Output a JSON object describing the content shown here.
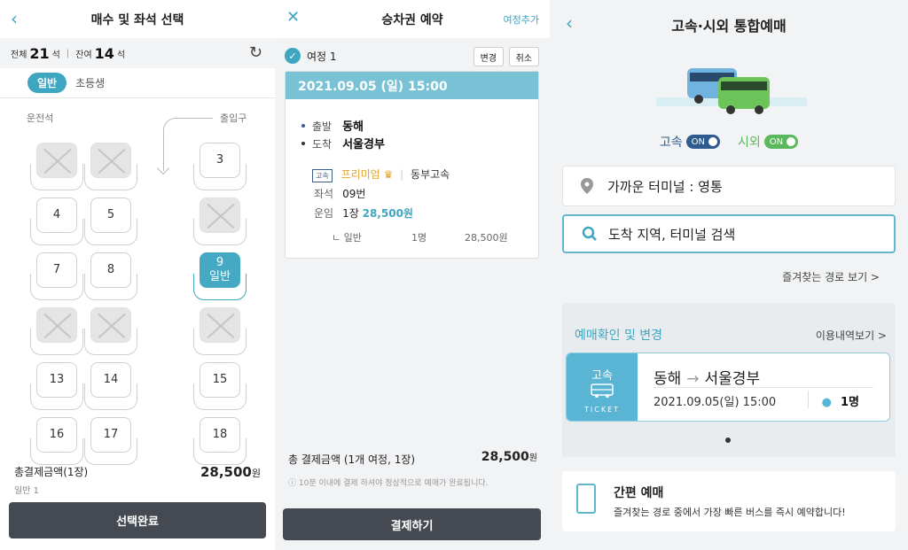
{
  "seat_screen": {
    "title": "매수 및 좌석 선택",
    "total_label": "전체",
    "total_count": "21",
    "remain_label": "잔여",
    "remain_count": "14",
    "unit": "석",
    "tab_general": "일반",
    "tab_child": "초등생",
    "driver_label": "운전석",
    "door_label": "출입구",
    "seats": {
      "s3": "3",
      "s4": "4",
      "s5": "5",
      "s7": "7",
      "s8": "8",
      "s9_num": "9",
      "s9_type": "일반",
      "s13": "13",
      "s14": "14",
      "s15": "15",
      "s16": "16",
      "s17": "17",
      "s18": "18"
    },
    "total_fare_label": "총결제금액(1장)",
    "total_fare": "28,500",
    "won": "원",
    "fare_sub": "일반 1",
    "confirm_button": "선택완료"
  },
  "booking_screen": {
    "title": "승차권 예약",
    "add_trip": "여정추가",
    "trip_label": "여정 1",
    "change_button": "변경",
    "cancel_button": "취소",
    "datetime": "2021.09.05 (일) 15:00",
    "depart_label": "출발",
    "depart": "동해",
    "arrive_label": "도착",
    "arrive": "서울경부",
    "grade_badge": "고속",
    "grade": "프리미엄",
    "company": "동부고속",
    "seat_label": "좌석",
    "seat_value": "09번",
    "fare_label": "운임",
    "fare_count": "1장",
    "fare_value": "28,500원",
    "fare_detail_type": "ㄴ 일반",
    "fare_detail_count": "1명",
    "fare_detail_amount": "28,500원",
    "total_label": "총 결제금액 (1개 여정, 1장)",
    "total_amount": "28,500",
    "won": "원",
    "notice": "ⓘ 10분 이내에 결제 하셔야 정상적으로 예매가 완료됩니다.",
    "pay_button": "결제하기"
  },
  "home_screen": {
    "title": "고속·시외 통합예매",
    "express_label": "고속",
    "express_state": "ON",
    "intercity_label": "시외",
    "intercity_state": "ON",
    "nearest_terminal": "가까운 터미널 : 영통",
    "search_placeholder": "도착 지역, 터미널 검색",
    "favorites_link": "즐겨찾는 경로 보기 >",
    "reservation_header": "예매확인 및 변경",
    "history_link": "이용내역보기 >",
    "ticket_type": "고속",
    "ticket_word": "TICKET",
    "ticket_from": "동해",
    "ticket_to": "서울경부",
    "ticket_date": "2021.09.05(일) 15:00",
    "ticket_count": "1명",
    "easy_title": "간편 예매",
    "easy_desc": "즐겨찾는 경로 중에서 가장 빠른 버스를 즉시 예약합니다!",
    "colors": {
      "accent": "#3ea6c1",
      "express_toggle": "#2f5c8f",
      "intercity_toggle": "#5cb85c",
      "dark_button": "#454a52"
    }
  }
}
